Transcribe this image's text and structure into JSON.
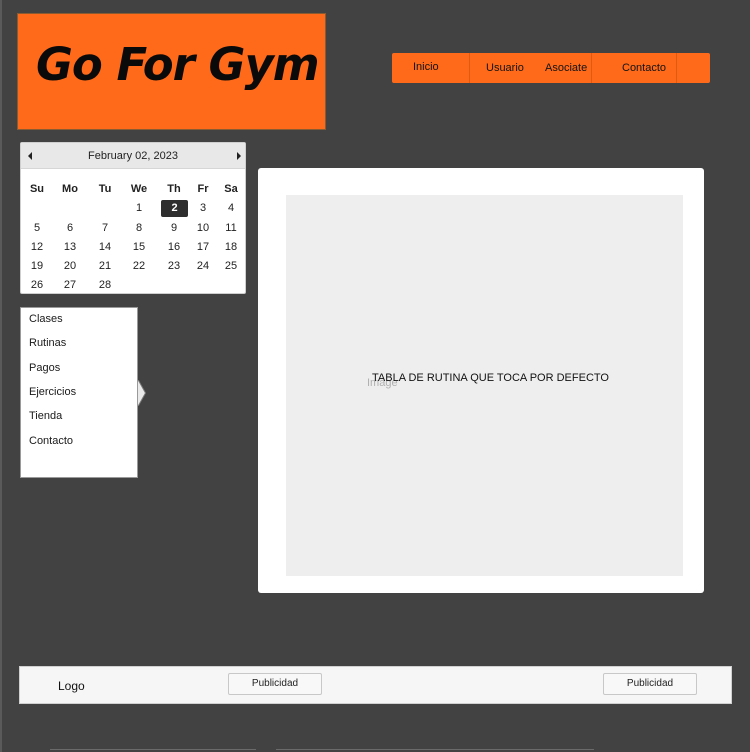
{
  "brand": {
    "logo_text": "Go For Gym",
    "colors": {
      "accent": "#ff6a1a",
      "background": "#424242"
    }
  },
  "topnav": {
    "items": [
      {
        "label": "Inicio"
      },
      {
        "label": "Usuario"
      },
      {
        "label": "Asociate"
      },
      {
        "label": "Contacto"
      }
    ]
  },
  "calendar": {
    "title": "February 02, 2023",
    "prev_icon": "triangle-left-icon",
    "next_icon": "triangle-right-icon",
    "weekdays": [
      "Su",
      "Mo",
      "Tu",
      "We",
      "Th",
      "Fr",
      "Sa"
    ],
    "weeks": [
      [
        "",
        "",
        "",
        "1",
        "2",
        "3",
        "4"
      ],
      [
        "5",
        "6",
        "7",
        "8",
        "9",
        "10",
        "11"
      ],
      [
        "12",
        "13",
        "14",
        "15",
        "16",
        "17",
        "18"
      ],
      [
        "19",
        "20",
        "21",
        "22",
        "23",
        "24",
        "25"
      ],
      [
        "26",
        "27",
        "28",
        "",
        "",
        "",
        ""
      ]
    ],
    "selected_day": "2"
  },
  "sidemenu": {
    "items": [
      {
        "label": "Clases"
      },
      {
        "label": "Rutinas"
      },
      {
        "label": "Pagos"
      },
      {
        "label": "Ejercicios",
        "active": true
      },
      {
        "label": "Tienda"
      },
      {
        "label": "Contacto"
      }
    ]
  },
  "main": {
    "image_placeholder_label": "Image",
    "caption": "TABLA DE RUTINA QUE TOCA POR DEFECTO"
  },
  "footer": {
    "logo": "Logo",
    "ad_left": "Publicidad",
    "ad_right": "Publicidad"
  }
}
